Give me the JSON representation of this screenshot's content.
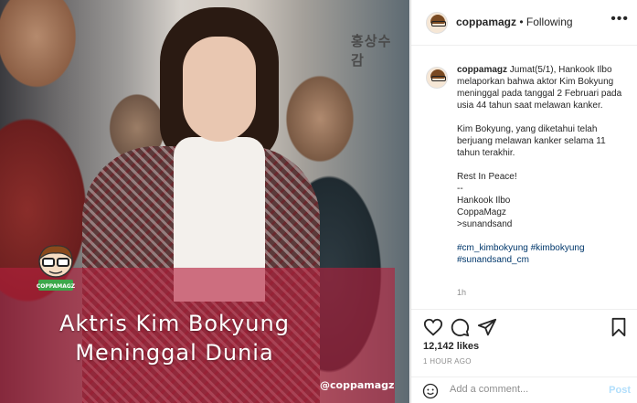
{
  "photo": {
    "poster_text": "홍상수 감",
    "caption_line1": "Aktris Kim Bokyung",
    "caption_line2": "Meninggal Dunia",
    "watermark": "@coppamagz",
    "mascot_label": "COPPAMAGZ"
  },
  "header": {
    "username": "coppamagz",
    "separator": " • ",
    "follow_status": "Following",
    "more_icon": "more-options-icon"
  },
  "post": {
    "username": "coppamagz",
    "para1": "Jumat(5/1), Hankook Ilbo melaporkan bahwa aktor Kim Bokyung meninggal pada tanggal 2 Februari pada usia 44 tahun saat melawan kanker.",
    "para2": "Kim Bokyung, yang diketahui telah berjuang melawan kanker selama 11 tahun terakhir.",
    "para3_line1": "Rest In Peace!",
    "para3_line2": "--",
    "para3_line3": "Hankook Ilbo",
    "para3_line4": "CoppaMagz",
    "para3_line5": ">sunandsand",
    "hashtags": "#cm_kimbokyung #kimbokyung #sunandsand_cm",
    "time_ago": "1h"
  },
  "actions": {
    "likes": "12,142 likes",
    "posted": "1 HOUR AGO",
    "comment_placeholder": "Add a comment...",
    "post_label": "Post"
  },
  "colors": {
    "caption_overlay": "#b41e3c",
    "hashtag": "#00376b",
    "post_button": "#b2dffc"
  }
}
